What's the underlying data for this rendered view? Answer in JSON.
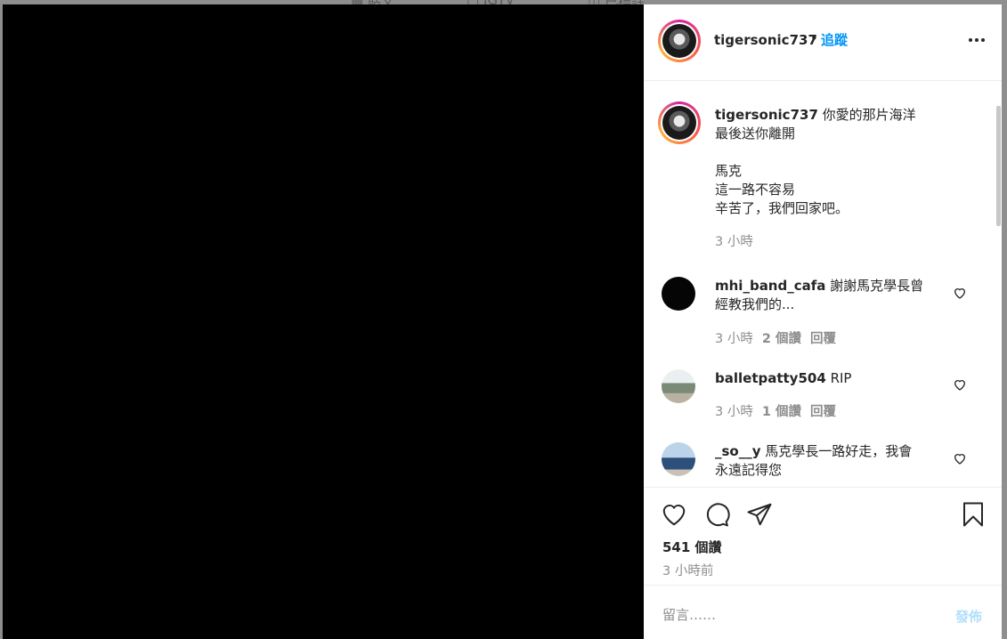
{
  "header": {
    "username": "tigersonic737",
    "separator": "•",
    "follow_label": "追蹤",
    "more_icon": "more-horizontal-icon"
  },
  "caption": {
    "username": "tigersonic737",
    "lines": [
      "你愛的那片海洋",
      "最後送你離開",
      "",
      "馬克",
      "這一路不容易",
      "辛苦了，我們回家吧。"
    ],
    "time": "3 小時"
  },
  "comments": [
    {
      "username": "mhi_band_cafa",
      "text_line1": "謝謝馬克學長曾",
      "text_line2": "經教我們的...",
      "time": "3 小時",
      "likes": "2 個讚",
      "reply": "回覆"
    },
    {
      "username": "balletpatty504",
      "text_line1": "RIP",
      "time": "3 小時",
      "likes": "1 個讚",
      "reply": "回覆"
    },
    {
      "username": "_so__y",
      "text_line1": "馬克學長一路好走，我會",
      "text_line2": "永遠記得您"
    }
  ],
  "actions": {
    "like_icon": "heart-icon",
    "comment_icon": "comment-icon",
    "share_icon": "paper-plane-icon",
    "save_icon": "bookmark-icon",
    "likes_count": "541 個讚",
    "posted_ago": "3 小時前"
  },
  "comment_box": {
    "placeholder": "留言……",
    "post_label": "發佈"
  },
  "colors": {
    "link_blue": "#0095f6",
    "disabled_blue": "#b2dffc",
    "secondary_text": "#8e8e8e"
  }
}
